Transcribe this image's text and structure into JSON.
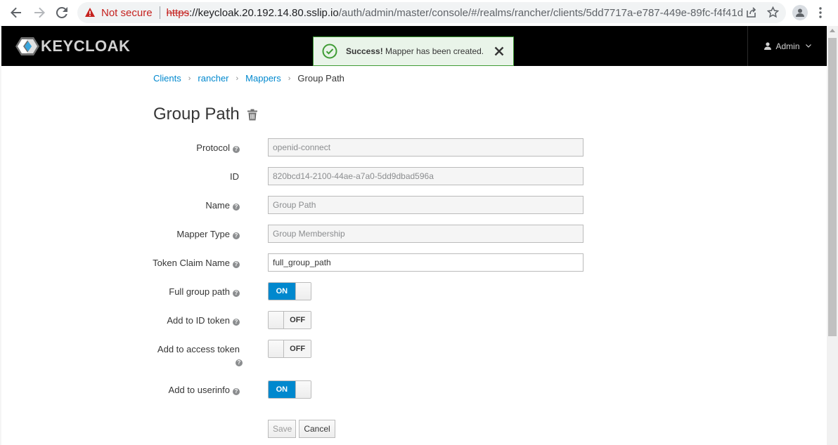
{
  "browser": {
    "not_secure_label": "Not secure",
    "url_scheme": "https",
    "url_host": "://keycloak.20.192.14.80.sslip.io",
    "url_path": "/auth/admin/master/console/#/realms/rancher/clients/5dd7717a-e787-449e-89fc-f4f41d723d..."
  },
  "header": {
    "logo_text": "KEYCLOAK",
    "user_label": "Admin"
  },
  "toast": {
    "title": "Success!",
    "message": " Mapper has been created."
  },
  "breadcrumb": {
    "items": [
      "Clients",
      "rancher",
      "Mappers"
    ],
    "current": "Group Path"
  },
  "page": {
    "title": "Group Path"
  },
  "form": {
    "protocol": {
      "label": "Protocol",
      "value": "openid-connect"
    },
    "id": {
      "label": "ID",
      "value": "820bcd14-2100-44ae-a7a0-5dd9dbad596a"
    },
    "name": {
      "label": "Name",
      "value": "Group Path"
    },
    "mapper_type": {
      "label": "Mapper Type",
      "value": "Group Membership"
    },
    "token_claim_name": {
      "label": "Token Claim Name",
      "value": "full_group_path"
    },
    "full_group_path": {
      "label": "Full group path",
      "state": "ON"
    },
    "add_to_id_token": {
      "label": "Add to ID token",
      "state": "OFF"
    },
    "add_to_access_token": {
      "label": "Add to access token",
      "state": "OFF"
    },
    "add_to_userinfo": {
      "label": "Add to userinfo",
      "state": "ON"
    }
  },
  "buttons": {
    "save": "Save",
    "cancel": "Cancel"
  },
  "colors": {
    "accent": "#0088ce",
    "success": "#3f9c35",
    "header_bg": "#000000",
    "warning": "#c5221f"
  }
}
